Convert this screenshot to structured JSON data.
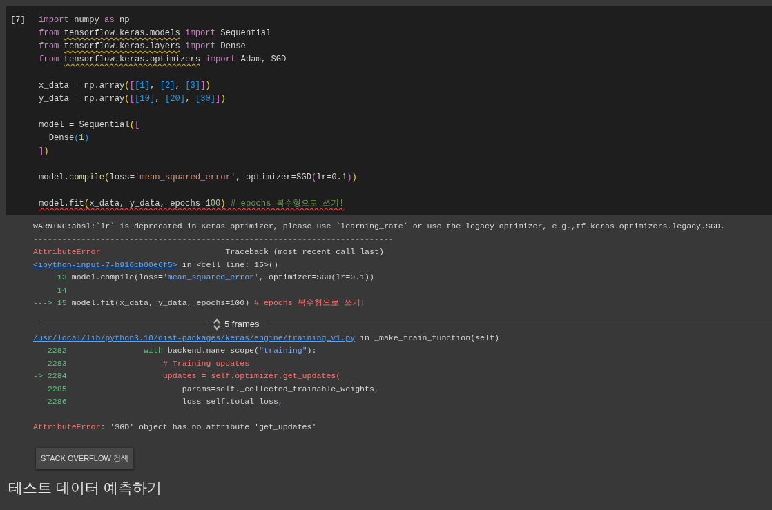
{
  "cell": {
    "execution_count": "[7]",
    "lines": [
      {
        "kind": "code",
        "tokens": [
          {
            "text": "import",
            "kind": "keyword"
          },
          {
            "text": " numpy ",
            "kind": "plain"
          },
          {
            "text": "as",
            "kind": "keyword"
          },
          {
            "text": " np",
            "kind": "plain"
          }
        ]
      },
      {
        "kind": "code",
        "tokens": [
          {
            "text": "from ",
            "kind": "keyword"
          },
          {
            "text": "tensorflow.keras.models",
            "kind": "plain",
            "warning": true
          },
          {
            "text": " import",
            "kind": "keyword"
          },
          {
            "text": " Sequential",
            "kind": "plain"
          }
        ]
      },
      {
        "kind": "code",
        "tokens": [
          {
            "text": "from ",
            "kind": "keyword"
          },
          {
            "text": "tensorflow.keras.layers",
            "kind": "plain",
            "warning": true
          },
          {
            "text": " import",
            "kind": "keyword"
          },
          {
            "text": " Dense",
            "kind": "plain"
          }
        ]
      },
      {
        "kind": "code",
        "tokens": [
          {
            "text": "from ",
            "kind": "keyword"
          },
          {
            "text": "tensorflow.keras.optimizers",
            "kind": "plain",
            "warning": true
          },
          {
            "text": " import",
            "kind": "keyword"
          },
          {
            "text": " Adam, SGD",
            "kind": "plain"
          }
        ]
      },
      {
        "kind": "blank"
      },
      {
        "kind": "code",
        "tokens": [
          {
            "text": "x_data = np.array",
            "kind": "plain"
          },
          {
            "text": "(",
            "kind": "bracket1"
          },
          {
            "text": "[",
            "kind": "bracket2"
          },
          {
            "text": "[1]",
            "kind": "bracket3"
          },
          {
            "text": ", ",
            "kind": "plain"
          },
          {
            "text": "[2]",
            "kind": "bracket3"
          },
          {
            "text": ", ",
            "kind": "plain"
          },
          {
            "text": "[3]",
            "kind": "bracket3"
          },
          {
            "text": "]",
            "kind": "bracket2"
          },
          {
            "text": ")",
            "kind": "bracket1"
          }
        ]
      },
      {
        "kind": "code",
        "tokens": [
          {
            "text": "y_data = np.array",
            "kind": "plain"
          },
          {
            "text": "(",
            "kind": "bracket1"
          },
          {
            "text": "[",
            "kind": "bracket2"
          },
          {
            "text": "[10]",
            "kind": "bracket3"
          },
          {
            "text": ", ",
            "kind": "plain"
          },
          {
            "text": "[20]",
            "kind": "bracket3"
          },
          {
            "text": ", ",
            "kind": "plain"
          },
          {
            "text": "[30]",
            "kind": "bracket3"
          },
          {
            "text": "]",
            "kind": "bracket2"
          },
          {
            "text": ")",
            "kind": "bracket1"
          }
        ]
      },
      {
        "kind": "blank"
      },
      {
        "kind": "code",
        "tokens": [
          {
            "text": "model = Sequential",
            "kind": "plain"
          },
          {
            "text": "(",
            "kind": "bracket1"
          },
          {
            "text": "[",
            "kind": "bracket2"
          }
        ]
      },
      {
        "kind": "code",
        "tokens": [
          {
            "text": "  Dense",
            "kind": "plain"
          },
          {
            "text": "(",
            "kind": "bracket3"
          },
          {
            "text": "1",
            "kind": "number"
          },
          {
            "text": ")",
            "kind": "bracket3"
          }
        ]
      },
      {
        "kind": "code",
        "tokens": [
          {
            "text": "]",
            "kind": "bracket2"
          },
          {
            "text": ")",
            "kind": "bracket1"
          }
        ]
      },
      {
        "kind": "blank"
      },
      {
        "kind": "code",
        "tokens": [
          {
            "text": "model.",
            "kind": "plain"
          },
          {
            "text": "compile",
            "kind": "function"
          },
          {
            "text": "(",
            "kind": "bracket1"
          },
          {
            "text": "loss=",
            "kind": "plain"
          },
          {
            "text": "'mean_squared_error'",
            "kind": "string"
          },
          {
            "text": ", optimizer=SGD",
            "kind": "plain"
          },
          {
            "text": "(",
            "kind": "bracket2"
          },
          {
            "text": "lr=",
            "kind": "plain"
          },
          {
            "text": "0.1",
            "kind": "number"
          },
          {
            "text": ")",
            "kind": "bracket2"
          },
          {
            "text": ")",
            "kind": "bracket1"
          }
        ]
      },
      {
        "kind": "blank"
      },
      {
        "kind": "code",
        "error": true,
        "tokens": [
          {
            "text": "model.fit",
            "kind": "plain"
          },
          {
            "text": "(",
            "kind": "bracket1"
          },
          {
            "text": "x_data, y_data, epochs=",
            "kind": "plain"
          },
          {
            "text": "100",
            "kind": "number"
          },
          {
            "text": ")",
            "kind": "bracket1"
          },
          {
            "text": " # epochs 복수형으로 쓰기!",
            "kind": "comment"
          }
        ]
      }
    ]
  },
  "output": {
    "lines": [
      {
        "kind": "text",
        "tokens": [
          {
            "text": "WARNING:absl:`lr` is deprecated in Keras optimizer, please use `learning_rate` or use the legacy optimizer, e.g.,tf.keras.optimizers.legacy.SGD.",
            "kind": "plain"
          }
        ]
      },
      {
        "kind": "text",
        "tokens": [
          {
            "text": "---------------------------------------------------------------------------",
            "kind": "error"
          }
        ]
      },
      {
        "kind": "text",
        "tokens": [
          {
            "text": "AttributeError",
            "kind": "error"
          },
          {
            "text": "                          Traceback (most recent call last)",
            "kind": "plain"
          }
        ]
      },
      {
        "kind": "text",
        "tokens": [
          {
            "text": "<ipython-input-7-b916cb00e6f5>",
            "kind": "link"
          },
          {
            "text": " in <cell line: 15>()",
            "kind": "plain"
          }
        ]
      },
      {
        "kind": "text",
        "tokens": [
          {
            "text": "     13 ",
            "kind": "lineno"
          },
          {
            "text": "model.compile(loss=",
            "kind": "plain"
          },
          {
            "text": "'mean_squared_error'",
            "kind": "string"
          },
          {
            "text": ", optimizer=SGD(lr=0.1))",
            "kind": "plain"
          }
        ]
      },
      {
        "kind": "text",
        "tokens": [
          {
            "text": "     14",
            "kind": "lineno"
          }
        ]
      },
      {
        "kind": "text",
        "tokens": [
          {
            "text": "---> 15 ",
            "kind": "lineno"
          },
          {
            "text": "model.fit(x_data, y_data, epochs=100) ",
            "kind": "plain"
          },
          {
            "text": "# epochs 복수형으로 쓰기!",
            "kind": "error"
          }
        ]
      }
    ],
    "frames": {
      "label": "5 frames",
      "expanded": false
    },
    "frame_lines": [
      {
        "kind": "text",
        "tokens": [
          {
            "text": "/usr/local/lib/python3.10/dist-packages/keras/engine/training_v1.py",
            "kind": "link"
          },
          {
            "text": " in _make_train_function(self)",
            "kind": "plain"
          }
        ]
      },
      {
        "kind": "text",
        "tokens": [
          {
            "text": "   2282                with",
            "kind": "lineno"
          },
          {
            "text": " backend.name_scope(",
            "kind": "plain"
          },
          {
            "text": "\"training\"",
            "kind": "string"
          },
          {
            "text": "):",
            "kind": "plain"
          }
        ]
      },
      {
        "kind": "text",
        "tokens": [
          {
            "text": "   2283                    ",
            "kind": "lineno"
          },
          {
            "text": "# Training updates",
            "kind": "error"
          }
        ]
      },
      {
        "kind": "text",
        "tokens": [
          {
            "text": "-> 2284                    ",
            "kind": "lineno"
          },
          {
            "text": "updates = self.optimizer.get_updates(",
            "kind": "error"
          }
        ]
      },
      {
        "kind": "text",
        "tokens": [
          {
            "text": "   2285                        ",
            "kind": "lineno"
          },
          {
            "text": "params=self._collected_trainable_weights",
            "kind": "plain"
          },
          {
            "text": ",",
            "kind": "string"
          }
        ]
      },
      {
        "kind": "text",
        "tokens": [
          {
            "text": "   2286                        ",
            "kind": "lineno"
          },
          {
            "text": "loss=self.total_loss",
            "kind": "plain"
          },
          {
            "text": ",",
            "kind": "string"
          }
        ]
      },
      {
        "kind": "blank"
      },
      {
        "kind": "text",
        "tokens": [
          {
            "text": "AttributeError",
            "kind": "error"
          },
          {
            "text": ": 'SGD' object has no attribute 'get_updates'",
            "kind": "plain"
          }
        ]
      }
    ],
    "search_button": "STACK OVERFLOW 검색"
  },
  "next_heading": "테스트 데이터 예측하기"
}
